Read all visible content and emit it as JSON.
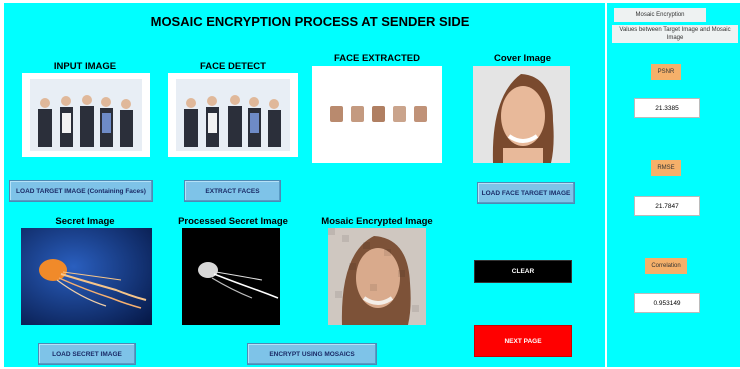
{
  "window_title": "MOSAIC ENCRYPTION PROCESS AT SENDER SIDE",
  "labels": {
    "input_image": "INPUT IMAGE",
    "face_detect": "FACE DETECT",
    "face_extracted": "FACE EXTRACTED",
    "cover_image": "Cover Image",
    "secret_image": "Secret Image",
    "processed_secret_image": "Processed Secret Image",
    "mosaic_encrypted_image": "Mosaic Encrypted Image"
  },
  "buttons": {
    "load_target": "LOAD TARGET IMAGE (Containing Faces)",
    "extract_faces": "EXTRACT FACES",
    "load_face_target": "LOAD FACE TARGET IMAGE",
    "load_secret": "LOAD SECRET IMAGE",
    "encrypt": "ENCRYPT USING MOSAICS",
    "clear": "CLEAR",
    "next_page": "NEXT PAGE"
  },
  "side_panel": {
    "header": "Mosaic Encryption",
    "subheader": "Values between Target Image and Mosaic Image",
    "psnr_label": "PSNR",
    "psnr_value": "21.3385",
    "rmse_label": "RMSE",
    "rmse_value": "21.7847",
    "correlation_label": "Correlation",
    "correlation_value": "0.953149"
  },
  "colors": {
    "background": "#00ffff",
    "button": "#7ec3e8",
    "clear_button": "#000000",
    "next_button": "#ff0000",
    "metric_label": "#f5b06a"
  }
}
